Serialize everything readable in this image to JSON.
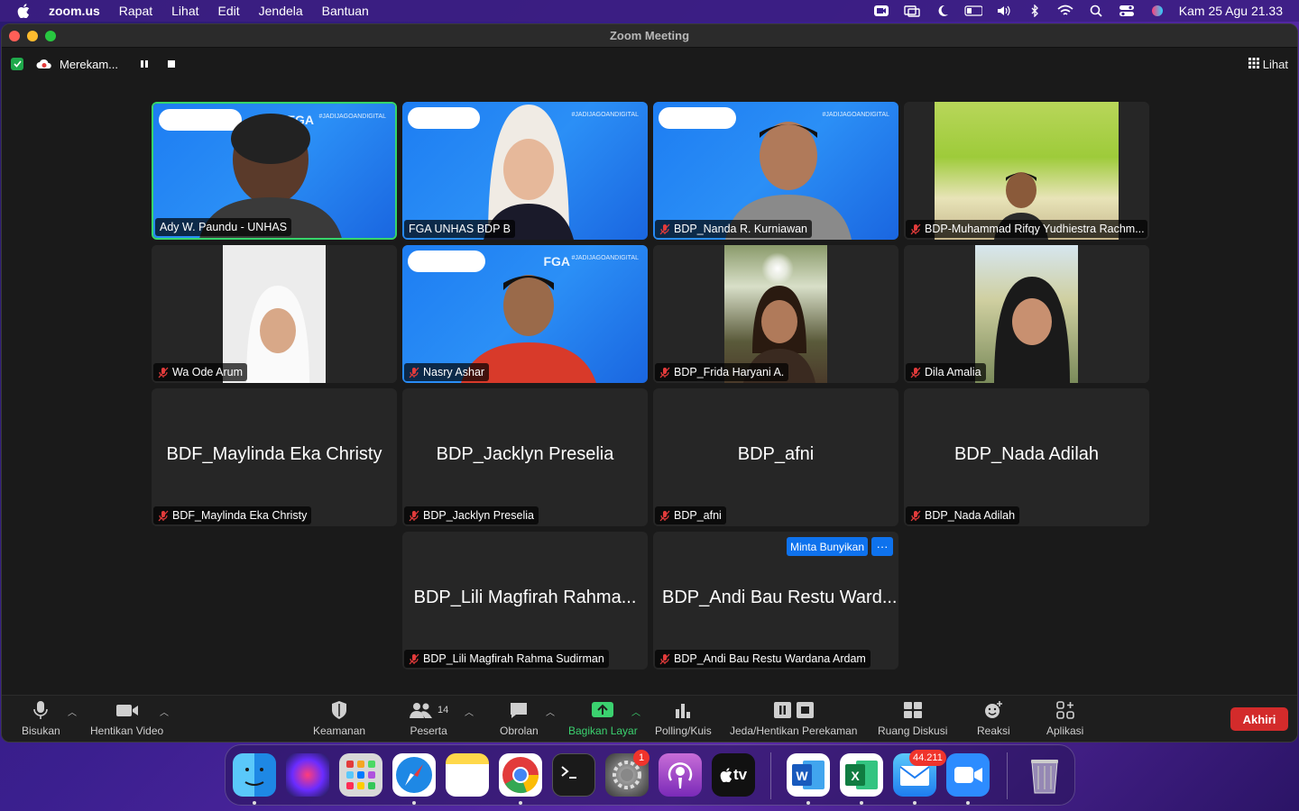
{
  "menubar": {
    "app_name": "zoom.us",
    "menus": [
      "Rapat",
      "Lihat",
      "Edit",
      "Jendela",
      "Bantuan"
    ],
    "clock": "Kam 25 Agu  21.33"
  },
  "window": {
    "title": "Zoom Meeting",
    "recording_label": "Merekam...",
    "view_label": "Lihat"
  },
  "tiles": [
    {
      "name": "Ady W. Paundu - UNHAS",
      "muted": false,
      "video": true
    },
    {
      "name": "FGA UNHAS BDP B",
      "muted": false,
      "video": true
    },
    {
      "name": "BDP_Nanda R. Kurniawan",
      "muted": true,
      "video": true
    },
    {
      "name": "BDP-Muhammad Rifqy Yudhiestra Rachm...",
      "muted": true,
      "video": true
    },
    {
      "name": "Wa Ode Arum",
      "muted": true,
      "video": true
    },
    {
      "name": "Nasry Ashar",
      "muted": true,
      "video": true
    },
    {
      "name": "BDP_Frida Haryani A.",
      "muted": true,
      "video": true
    },
    {
      "name": "Dila Amalia",
      "muted": true,
      "video": true
    },
    {
      "name": "BDF_Maylinda Eka Christy",
      "display": "BDF_Maylinda Eka Christy",
      "muted": true,
      "video": false
    },
    {
      "name": "BDP_Jacklyn Preselia",
      "display": "BDP_Jacklyn Preselia",
      "muted": true,
      "video": false
    },
    {
      "name": "BDP_afni",
      "display": "BDP_afni",
      "muted": true,
      "video": false
    },
    {
      "name": "BDP_Nada Adilah",
      "display": "BDP_Nada Adilah",
      "muted": true,
      "video": false
    },
    {
      "name": "BDP_Lili Magfirah Rahma Sudirman",
      "display": "BDP_Lili Magfirah Rahma...",
      "muted": true,
      "video": false
    },
    {
      "name": "BDP_Andi Bau Restu Wardana Ardam",
      "display": "BDP_Andi Bau Restu Ward...",
      "muted": true,
      "video": false
    }
  ],
  "hover_tile": {
    "ask_unmute_label": "Minta Bunyikan",
    "more_label": "···"
  },
  "video_overlay": {
    "fga_text": "FGA",
    "fga_tag": "#JADIJAGOANDIGITAL"
  },
  "toolbar": {
    "mute_label": "Bisukan",
    "video_label": "Hentikan Video",
    "security_label": "Keamanan",
    "participants_label": "Peserta",
    "participants_count": "14",
    "chat_label": "Obrolan",
    "share_label": "Bagikan Layar",
    "polls_label": "Polling/Kuis",
    "record_label": "Jeda/Hentikan Perekaman",
    "breakout_label": "Ruang Diskusi",
    "reactions_label": "Reaksi",
    "apps_label": "Aplikasi",
    "end_label": "Akhiri"
  },
  "dock": {
    "settings_badge": "1",
    "mail_badge": "44.211",
    "tv_label": "tv"
  },
  "colors": {
    "active_speaker": "#36d56b",
    "share_green": "#3bd16f",
    "end_red": "#d32b2b",
    "zoom_blue": "#0e72ed"
  }
}
